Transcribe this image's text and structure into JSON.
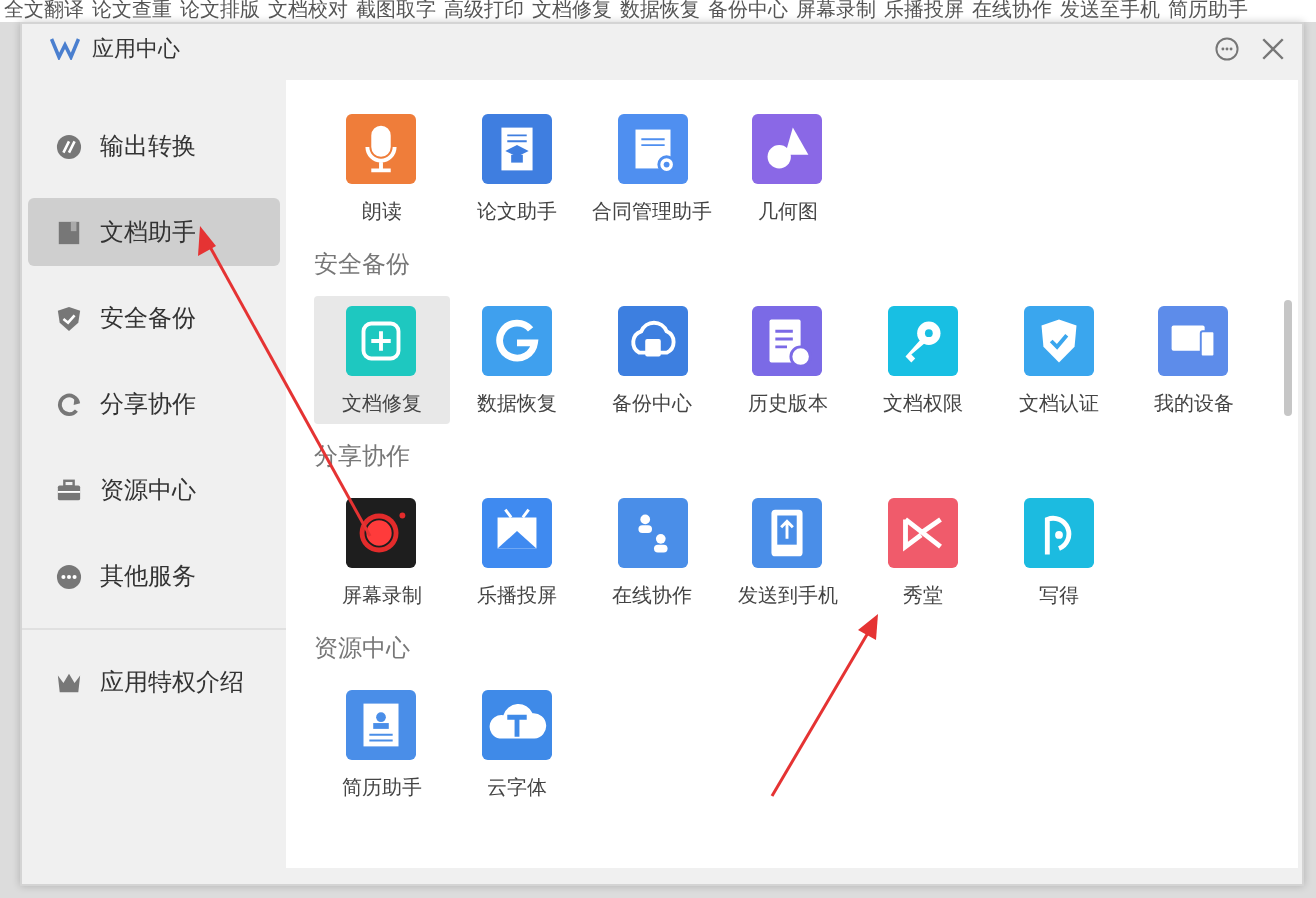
{
  "background_toolbar": [
    "全文翻译",
    "论文查重",
    "论文排版",
    "文档校对",
    "截图取字",
    "高级打印",
    "文档修复",
    "数据恢复",
    "备份中心",
    "屏幕录制",
    "乐播投屏",
    "在线协作",
    "发送至手机",
    "简历助手"
  ],
  "window": {
    "title": "应用中心"
  },
  "sidebar": {
    "items": [
      {
        "label": "输出转换",
        "kind": "convert",
        "selected": false
      },
      {
        "label": "文档助手",
        "kind": "book",
        "selected": true
      },
      {
        "label": "安全备份",
        "kind": "shield",
        "selected": false
      },
      {
        "label": "分享协作",
        "kind": "cycle",
        "selected": false
      },
      {
        "label": "资源中心",
        "kind": "bag",
        "selected": false
      },
      {
        "label": "其他服务",
        "kind": "dots",
        "selected": false
      }
    ],
    "footer": {
      "label": "应用特权介绍"
    }
  },
  "sections": [
    {
      "apps": [
        {
          "label": "朗读",
          "kind": "mic",
          "color": "#ef7d3a",
          "selected": false
        },
        {
          "label": "论文助手",
          "kind": "cap",
          "color": "#3f7ee0",
          "selected": false
        },
        {
          "label": "合同管理助手",
          "kind": "doc",
          "color": "#4f8ff0",
          "selected": false
        },
        {
          "label": "几何图",
          "kind": "shapes",
          "color": "#8a68e6",
          "selected": false
        }
      ]
    },
    {
      "title": "安全备份",
      "apps": [
        {
          "label": "文档修复",
          "kind": "repair",
          "color": "#1ec8c0",
          "selected": true
        },
        {
          "label": "数据恢复",
          "kind": "g",
          "color": "#3fa0ee",
          "selected": false
        },
        {
          "label": "备份中心",
          "kind": "cloud",
          "color": "#3d7fe0",
          "selected": false
        },
        {
          "label": "历史版本",
          "kind": "history",
          "color": "#7b6ae6",
          "selected": false
        },
        {
          "label": "文档权限",
          "kind": "key",
          "color": "#18bfe3",
          "selected": false
        },
        {
          "label": "文档认证",
          "kind": "check",
          "color": "#3aa6ee",
          "selected": false
        },
        {
          "label": "我的设备",
          "kind": "devices",
          "color": "#5d8cea",
          "selected": false
        }
      ]
    },
    {
      "title": "分享协作",
      "apps": [
        {
          "label": "屏幕录制",
          "kind": "record",
          "color": "#1e1e1e",
          "selected": false
        },
        {
          "label": "乐播投屏",
          "kind": "tv",
          "color": "#3f8af0",
          "selected": false
        },
        {
          "label": "在线协作",
          "kind": "people",
          "color": "#4a8ee8",
          "selected": false
        },
        {
          "label": "发送到手机",
          "kind": "phone",
          "color": "#4a8ee8",
          "selected": false
        },
        {
          "label": "秀堂",
          "kind": "bow",
          "color": "#f05b6b",
          "selected": false
        },
        {
          "label": "写得",
          "kind": "loop",
          "color": "#1cbbe0",
          "selected": false
        }
      ]
    },
    {
      "title": "资源中心",
      "apps": [
        {
          "label": "简历助手",
          "kind": "card",
          "color": "#4a8ee8",
          "selected": false
        },
        {
          "label": "云字体",
          "kind": "cloudt",
          "color": "#3f8ae8",
          "selected": false
        }
      ]
    }
  ]
}
